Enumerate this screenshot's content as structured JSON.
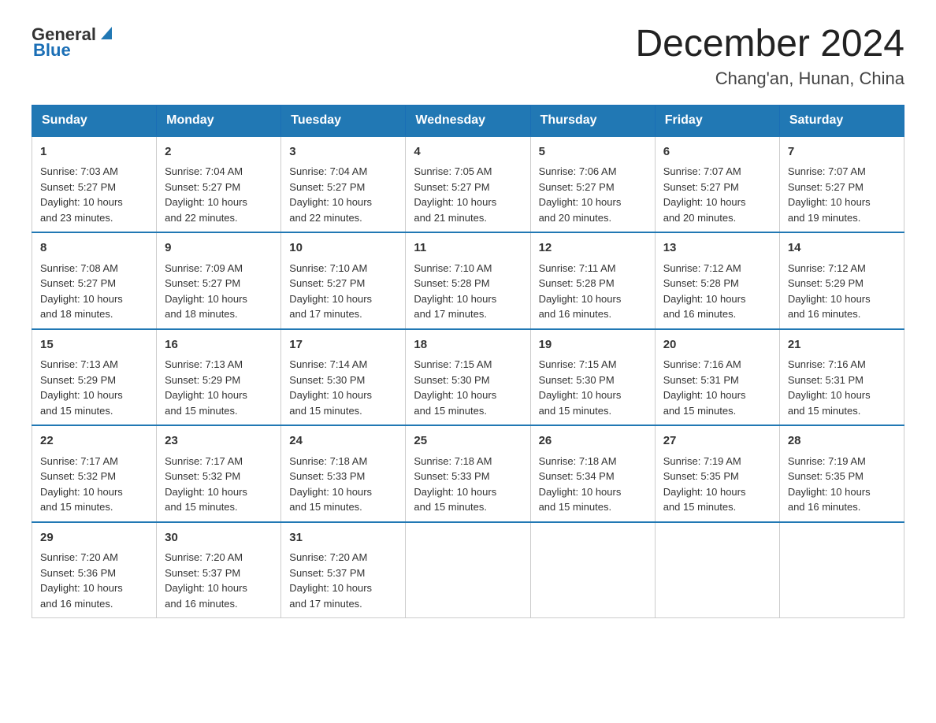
{
  "header": {
    "logo_general": "General",
    "logo_blue": "Blue",
    "month_title": "December 2024",
    "location": "Chang'an, Hunan, China"
  },
  "days_of_week": [
    "Sunday",
    "Monday",
    "Tuesday",
    "Wednesday",
    "Thursday",
    "Friday",
    "Saturday"
  ],
  "weeks": [
    [
      {
        "day": "1",
        "sunrise": "7:03 AM",
        "sunset": "5:27 PM",
        "daylight": "10 hours and 23 minutes."
      },
      {
        "day": "2",
        "sunrise": "7:04 AM",
        "sunset": "5:27 PM",
        "daylight": "10 hours and 22 minutes."
      },
      {
        "day": "3",
        "sunrise": "7:04 AM",
        "sunset": "5:27 PM",
        "daylight": "10 hours and 22 minutes."
      },
      {
        "day": "4",
        "sunrise": "7:05 AM",
        "sunset": "5:27 PM",
        "daylight": "10 hours and 21 minutes."
      },
      {
        "day": "5",
        "sunrise": "7:06 AM",
        "sunset": "5:27 PM",
        "daylight": "10 hours and 20 minutes."
      },
      {
        "day": "6",
        "sunrise": "7:07 AM",
        "sunset": "5:27 PM",
        "daylight": "10 hours and 20 minutes."
      },
      {
        "day": "7",
        "sunrise": "7:07 AM",
        "sunset": "5:27 PM",
        "daylight": "10 hours and 19 minutes."
      }
    ],
    [
      {
        "day": "8",
        "sunrise": "7:08 AM",
        "sunset": "5:27 PM",
        "daylight": "10 hours and 18 minutes."
      },
      {
        "day": "9",
        "sunrise": "7:09 AM",
        "sunset": "5:27 PM",
        "daylight": "10 hours and 18 minutes."
      },
      {
        "day": "10",
        "sunrise": "7:10 AM",
        "sunset": "5:27 PM",
        "daylight": "10 hours and 17 minutes."
      },
      {
        "day": "11",
        "sunrise": "7:10 AM",
        "sunset": "5:28 PM",
        "daylight": "10 hours and 17 minutes."
      },
      {
        "day": "12",
        "sunrise": "7:11 AM",
        "sunset": "5:28 PM",
        "daylight": "10 hours and 16 minutes."
      },
      {
        "day": "13",
        "sunrise": "7:12 AM",
        "sunset": "5:28 PM",
        "daylight": "10 hours and 16 minutes."
      },
      {
        "day": "14",
        "sunrise": "7:12 AM",
        "sunset": "5:29 PM",
        "daylight": "10 hours and 16 minutes."
      }
    ],
    [
      {
        "day": "15",
        "sunrise": "7:13 AM",
        "sunset": "5:29 PM",
        "daylight": "10 hours and 15 minutes."
      },
      {
        "day": "16",
        "sunrise": "7:13 AM",
        "sunset": "5:29 PM",
        "daylight": "10 hours and 15 minutes."
      },
      {
        "day": "17",
        "sunrise": "7:14 AM",
        "sunset": "5:30 PM",
        "daylight": "10 hours and 15 minutes."
      },
      {
        "day": "18",
        "sunrise": "7:15 AM",
        "sunset": "5:30 PM",
        "daylight": "10 hours and 15 minutes."
      },
      {
        "day": "19",
        "sunrise": "7:15 AM",
        "sunset": "5:30 PM",
        "daylight": "10 hours and 15 minutes."
      },
      {
        "day": "20",
        "sunrise": "7:16 AM",
        "sunset": "5:31 PM",
        "daylight": "10 hours and 15 minutes."
      },
      {
        "day": "21",
        "sunrise": "7:16 AM",
        "sunset": "5:31 PM",
        "daylight": "10 hours and 15 minutes."
      }
    ],
    [
      {
        "day": "22",
        "sunrise": "7:17 AM",
        "sunset": "5:32 PM",
        "daylight": "10 hours and 15 minutes."
      },
      {
        "day": "23",
        "sunrise": "7:17 AM",
        "sunset": "5:32 PM",
        "daylight": "10 hours and 15 minutes."
      },
      {
        "day": "24",
        "sunrise": "7:18 AM",
        "sunset": "5:33 PM",
        "daylight": "10 hours and 15 minutes."
      },
      {
        "day": "25",
        "sunrise": "7:18 AM",
        "sunset": "5:33 PM",
        "daylight": "10 hours and 15 minutes."
      },
      {
        "day": "26",
        "sunrise": "7:18 AM",
        "sunset": "5:34 PM",
        "daylight": "10 hours and 15 minutes."
      },
      {
        "day": "27",
        "sunrise": "7:19 AM",
        "sunset": "5:35 PM",
        "daylight": "10 hours and 15 minutes."
      },
      {
        "day": "28",
        "sunrise": "7:19 AM",
        "sunset": "5:35 PM",
        "daylight": "10 hours and 16 minutes."
      }
    ],
    [
      {
        "day": "29",
        "sunrise": "7:20 AM",
        "sunset": "5:36 PM",
        "daylight": "10 hours and 16 minutes."
      },
      {
        "day": "30",
        "sunrise": "7:20 AM",
        "sunset": "5:37 PM",
        "daylight": "10 hours and 16 minutes."
      },
      {
        "day": "31",
        "sunrise": "7:20 AM",
        "sunset": "5:37 PM",
        "daylight": "10 hours and 17 minutes."
      },
      null,
      null,
      null,
      null
    ]
  ],
  "labels": {
    "sunrise": "Sunrise:",
    "sunset": "Sunset:",
    "daylight": "Daylight:"
  }
}
